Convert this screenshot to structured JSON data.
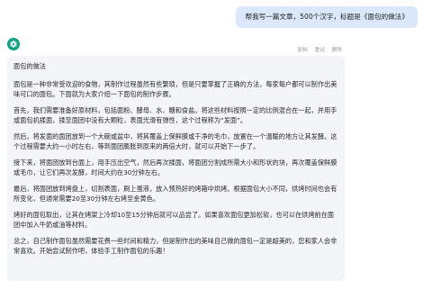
{
  "user_message": "帮我写一篇文章，500个汉字，标题是《面包的做法》",
  "actions": {
    "copy": "复制",
    "retry": "重试",
    "delete": "删除"
  },
  "assistant": {
    "title": "面包的做法",
    "paragraphs": [
      "面包是一种非常受欢迎的食物，其制作过程虽然有些繁琐，但是只要掌握了正确的方法，每家每户都可以制作出美味可口的面包。下面就为大家介绍一下面包的制作步骤。",
      "首先，我们需要准备好原材料，包括面粉、酵母、水、糖和食盐。将这些材料按照一定的比例混合在一起，并用手或面包机揉面，揉至面团中没有大颗粒，表面光滑有弹性，这个过程称为“发面”。",
      "然后，将发面的面团放到一个大碗或盆中，将其覆盖上保鲜膜或干净的毛巾，放置在一个温暖的地方让其发酵。这个过程需要大约一小时左右，等到面团膨胀到原来的两倍大时，就可以开始下一步了。",
      "接下来，将面团放到台面上，用手压出空气，然后再次揉面，将面团分割成所需大小和形状的块，再次覆盖保鲜膜或毛巾，让它们再次发酵，时间大约在30分钟左右。",
      "最后，将面团放到烤盘上，切割表面，刷上蛋液，放入预热好的烤箱中烘烤。根据面包大小不同，烘烤时间也会有所变化，但通常需要20至30分钟左右烤至金黄色。",
      "烤好的面包取出，让其在烤架上冷却10至15分钟后就可以品尝了。如果喜欢面包更加松软，也可以在烘烤前在面团中加入牛奶或油等材料。",
      "总之，自己制作面包虽然需要花费一些时间和精力，但是制作出的美味自己做的面包一定是超美的，您和家人会非常喜欢。开始尝试制作吧，体验手工制作面包的乐趣！"
    ]
  }
}
